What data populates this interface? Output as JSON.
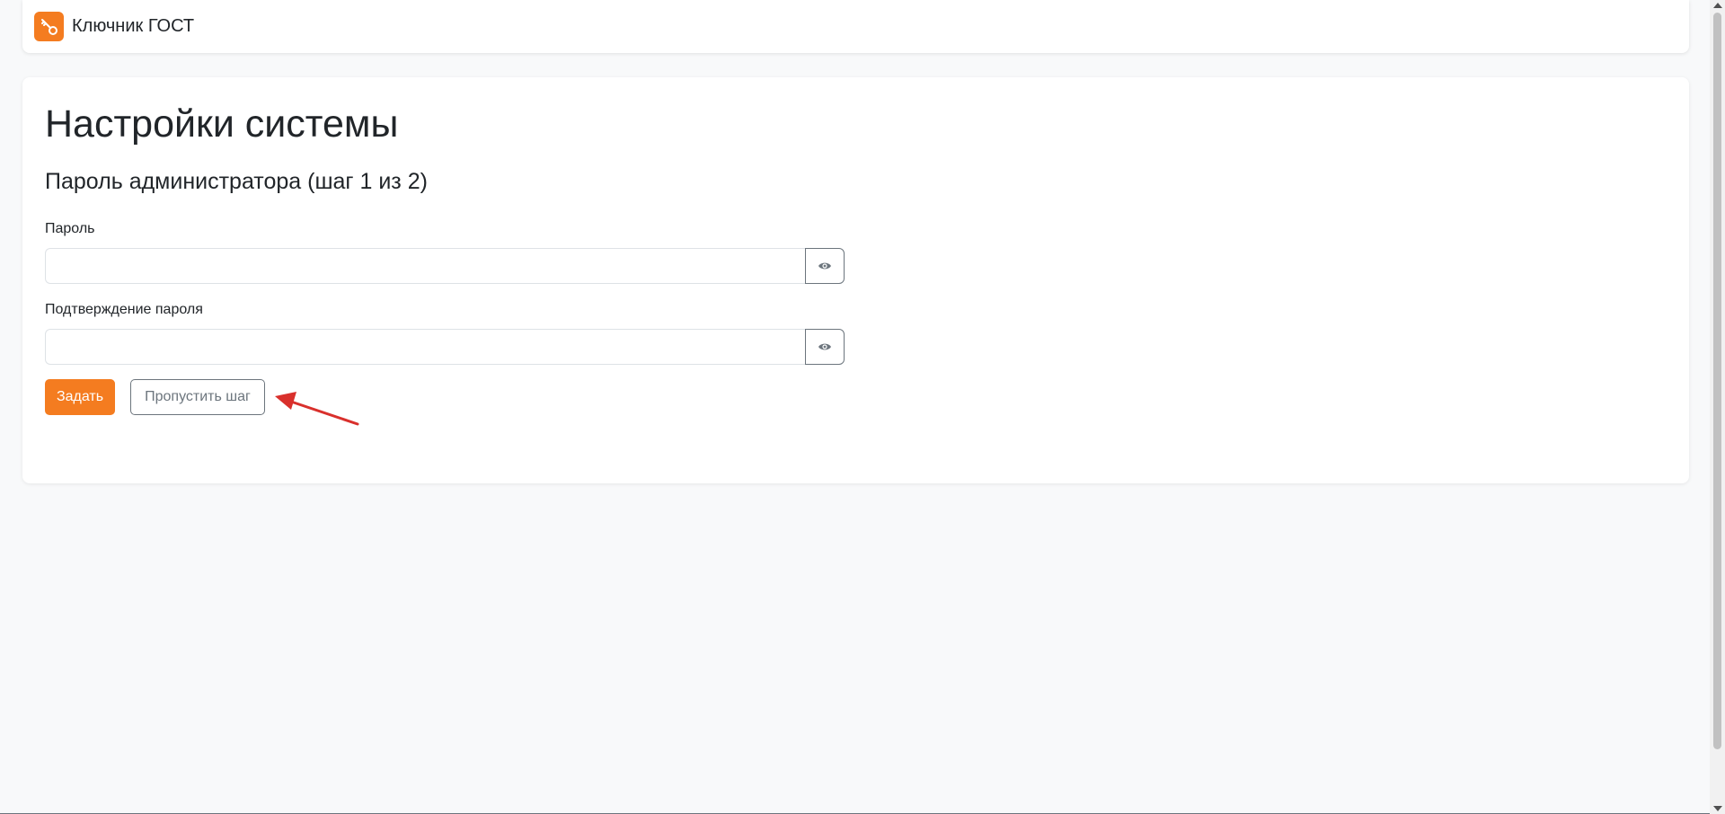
{
  "header": {
    "brand": "Ключник ГОСТ",
    "logo_icon": "key-icon",
    "accent_color": "#f47c20"
  },
  "main": {
    "title": "Настройки системы",
    "section_title": "Пароль администратора (шаг 1 из 2)",
    "fields": [
      {
        "label": "Пароль",
        "value": "",
        "toggle_icon": "eye-icon"
      },
      {
        "label": "Подтверждение пароля",
        "value": "",
        "toggle_icon": "eye-icon"
      }
    ],
    "buttons": {
      "submit_label": "Задать",
      "skip_label": "Пропустить шаг"
    }
  },
  "annotation": {
    "arrow_color": "#d9302c",
    "arrow_icon": "red-arrow-icon"
  }
}
